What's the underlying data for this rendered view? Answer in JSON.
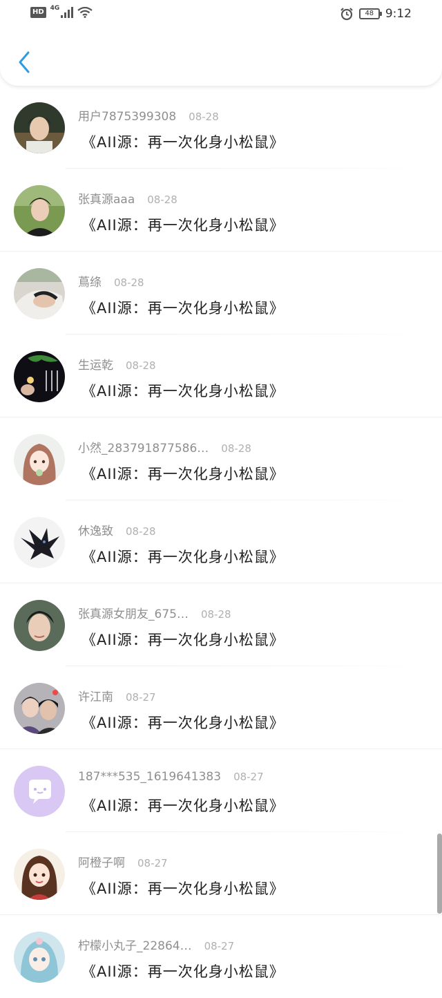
{
  "status_bar": {
    "hd": "HD",
    "network": "4G",
    "battery": "48",
    "time": "9:12"
  },
  "colors": {
    "accent": "#2f9be0"
  },
  "icons": {
    "back": "chevron-left-icon"
  },
  "comments": [
    {
      "user": "用户7875399308",
      "date": "08-28",
      "text": "《AII源：再一次化身小松鼠》"
    },
    {
      "user": "张真源aaa",
      "date": "08-28",
      "text": "《AII源：再一次化身小松鼠》"
    },
    {
      "user": "蔦绦",
      "date": "08-28",
      "text": "《AII源：再一次化身小松鼠》"
    },
    {
      "user": "生运乾",
      "date": "08-28",
      "text": "《AII源：再一次化身小松鼠》"
    },
    {
      "user": "小然_283791877586…",
      "date": "08-28",
      "text": "《AII源：再一次化身小松鼠》"
    },
    {
      "user": "休逸致",
      "date": "08-28",
      "text": "《AII源：再一次化身小松鼠》"
    },
    {
      "user": "张真源女朋友_675…",
      "date": "08-28",
      "text": "《AII源：再一次化身小松鼠》"
    },
    {
      "user": "许江南",
      "date": "08-27",
      "text": "《AII源：再一次化身小松鼠》"
    },
    {
      "user": "187***535_1619641383",
      "date": "08-27",
      "text": "《AII源：再一次化身小松鼠》"
    },
    {
      "user": "阿橙子啊",
      "date": "08-27",
      "text": "《AII源：再一次化身小松鼠》"
    },
    {
      "user": "柠檬小丸子_22864…",
      "date": "08-27",
      "text": "《AII源：再一次化身小松鼠》"
    }
  ]
}
